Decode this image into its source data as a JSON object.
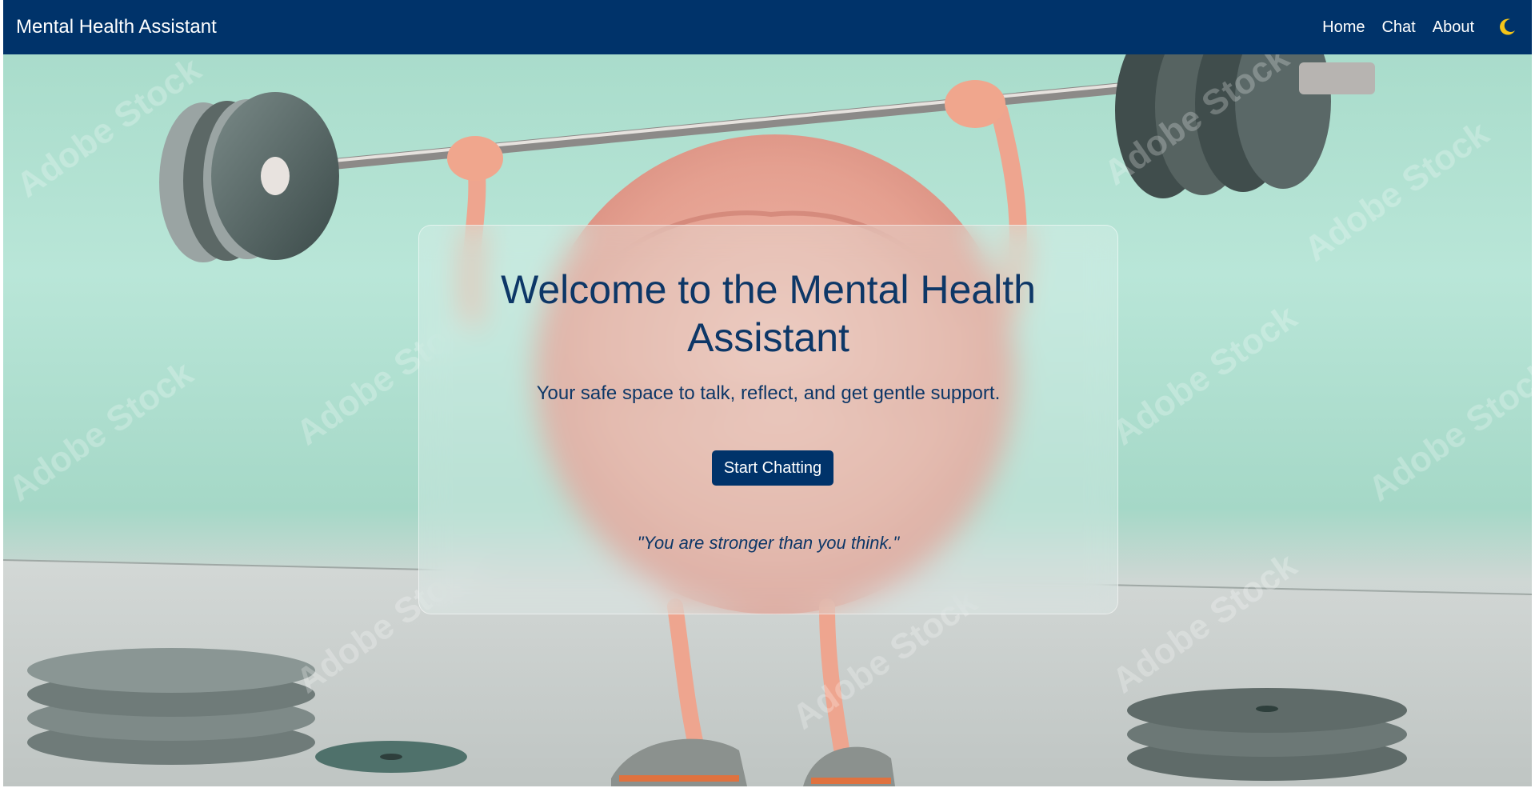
{
  "navbar": {
    "brand": "Mental Health Assistant",
    "links": [
      "Home",
      "Chat",
      "About"
    ],
    "theme_toggle_icon": "moon-icon",
    "background_color": "#00336a"
  },
  "hero": {
    "title": "Welcome to the Mental Health Assistant",
    "subtitle": "Your safe space to talk, reflect, and get gentle support.",
    "cta_label": "Start Chatting",
    "quote": "\"You are stronger than you think.\"",
    "background_image": "brain-lifting-barbell-image",
    "watermark": "Adobe Stock"
  },
  "colors": {
    "primary": "#00336a",
    "text": "#0d3767",
    "moon": "#f5c518"
  }
}
